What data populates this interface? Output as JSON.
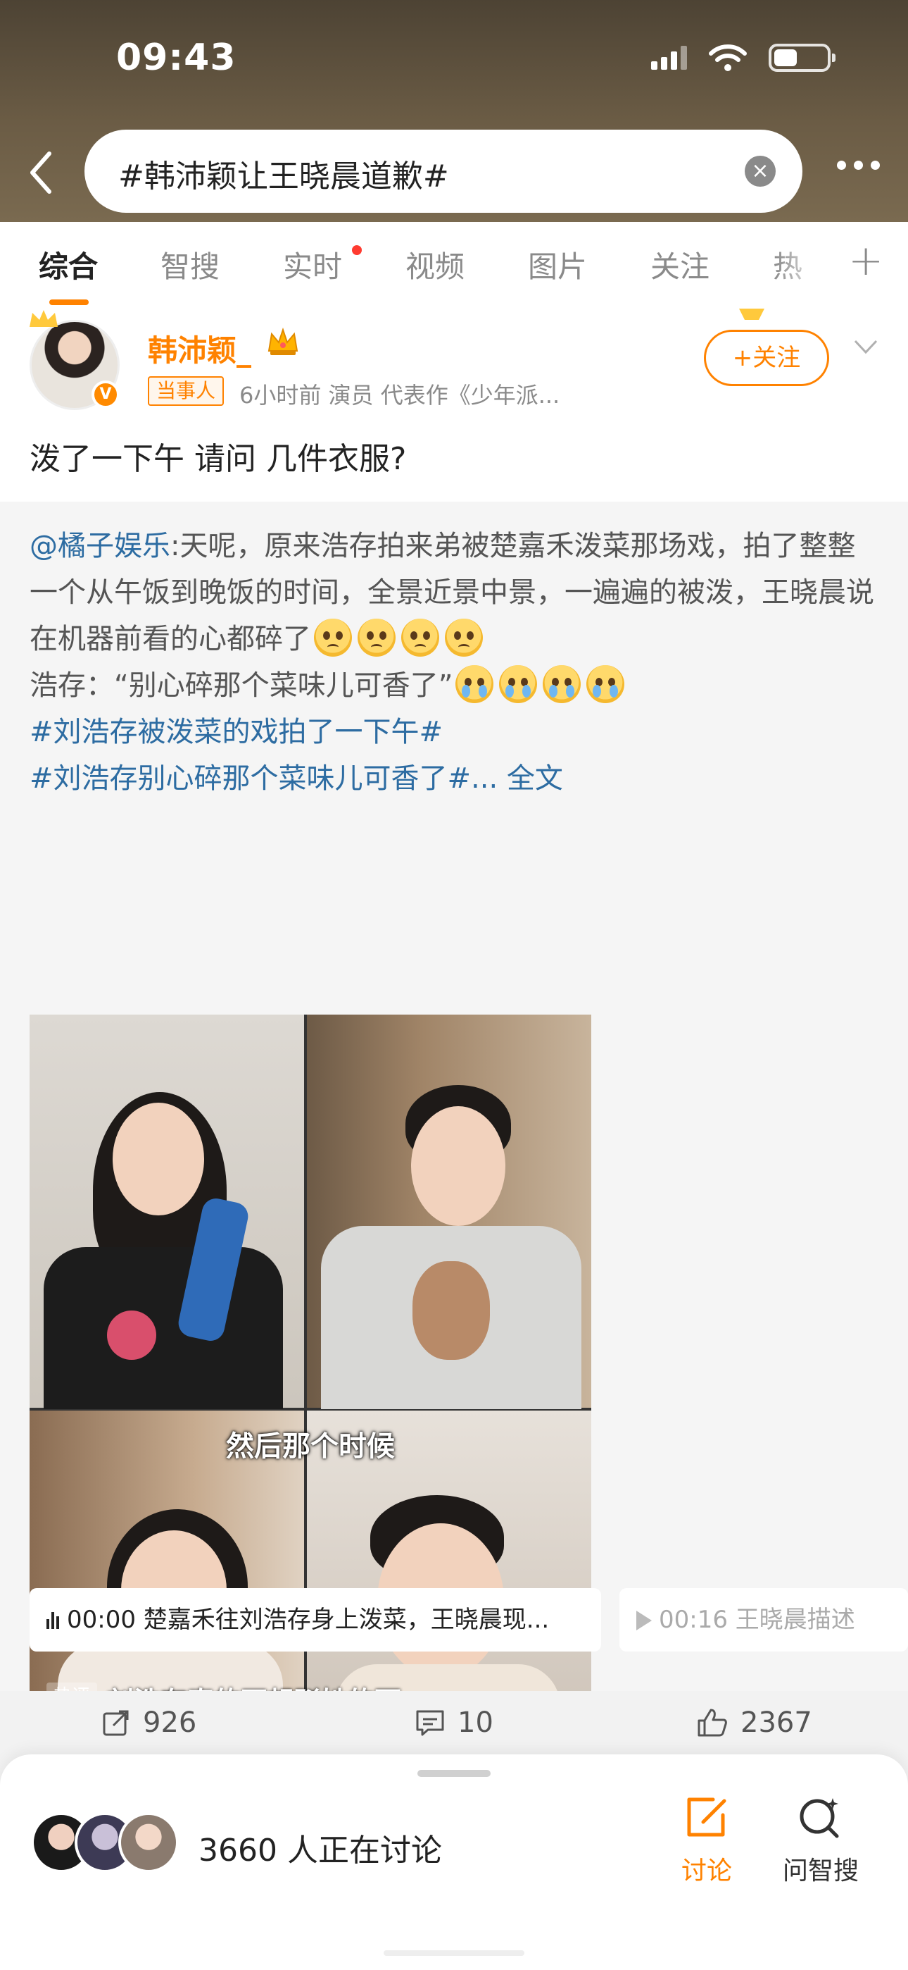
{
  "status_bar": {
    "time": "09:43"
  },
  "search": {
    "query": "#韩沛颖让王晓晨道歉#"
  },
  "tabs": [
    {
      "label": "综合",
      "active": true
    },
    {
      "label": "智搜"
    },
    {
      "label": "实时",
      "dot": true
    },
    {
      "label": "视频"
    },
    {
      "label": "图片"
    },
    {
      "label": "关注"
    },
    {
      "label": "热"
    }
  ],
  "post": {
    "author": "韩沛颖_",
    "role_badge": "当事人",
    "meta": "6小时前  演员 代表作《少年派...",
    "follow_label": "+关注",
    "text": "泼了一下午 请问 几件衣服?"
  },
  "repost": {
    "mention": "@橘子娱乐",
    "body": ":天呢，原来浩存拍来弟被楚嘉禾泼菜那场戏，拍了整整一个从午饭到晚饭的时间，全景近景中景，一遍遍的被泼，王晓晨说在机器前看的心都碎了",
    "quote": "浩存：“别心碎那个菜味儿可香了”",
    "hashtag1": "#刘浩存被泼菜的戏拍了一下午#",
    "hashtag2": "#刘浩存别心碎那个菜味儿可香了#",
    "ellipsis": "...",
    "full_text": " 全文",
    "video_subtitle": "然后那个时候",
    "hot_badge": "热评",
    "hot_comment": "刘浩存真的不想驳她的面...",
    "chapter1": "00:00 楚嘉禾往刘浩存身上泼菜，王晓晨现...",
    "chapter2": "00:16 王晓晨描述"
  },
  "actions": {
    "reposts": "926",
    "comments": "10",
    "likes": "2367"
  },
  "sheet": {
    "discussing": "3660 人正在讨论",
    "discuss_label": "讨论",
    "ask_label": "问智搜"
  },
  "colors": {
    "accent": "#ff8200",
    "link": "#2d6ca2"
  }
}
